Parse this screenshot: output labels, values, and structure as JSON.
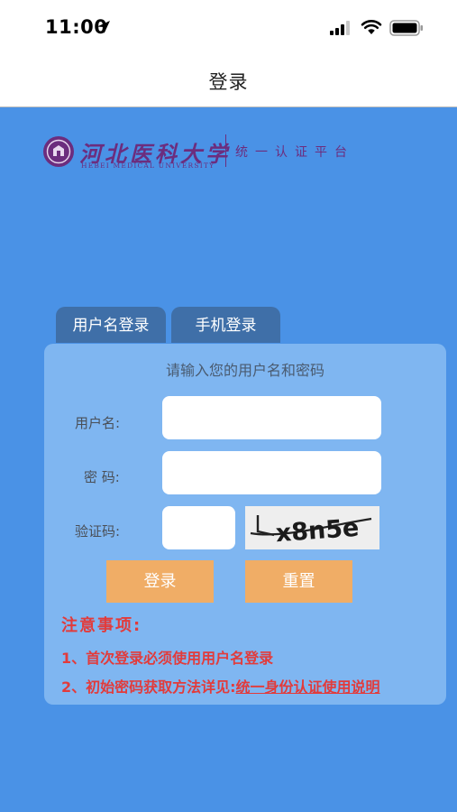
{
  "status_bar": {
    "time": "11:00"
  },
  "nav": {
    "title": "登录"
  },
  "logo": {
    "school_name": "河北医科大学",
    "school_name_en": "HEBEI MEDICAL UNIVERSITY",
    "platform": "统一认证平台"
  },
  "tabs": [
    {
      "label": "用户名登录"
    },
    {
      "label": "手机登录"
    }
  ],
  "form": {
    "hint": "请输入您的用户名和密码",
    "username_label": "用户名:",
    "username_value": "",
    "password_label": "密 码:",
    "password_value": "",
    "captcha_label": "验证码:",
    "captcha_value": "",
    "captcha_text": "x8n5e",
    "login_button": "登录",
    "reset_button": "重置"
  },
  "notes": {
    "title": "注意事项:",
    "item1": "1、首次登录必须使用用户名登录",
    "item2_prefix": "2、初始密码获取方法详见:",
    "item2_link": "统一身份认证使用说明"
  },
  "colors": {
    "main_bg": "#4a92e6",
    "card_bg": "#7fb6f1",
    "tab_bg": "#3f6fa8",
    "button_bg": "#f0ad66",
    "notes_red": "#e23b3b",
    "logo_purple": "#6c2d7e"
  },
  "icons": [
    "location-arrow-icon",
    "signal-icon",
    "wifi-icon",
    "battery-icon",
    "university-emblem-icon"
  ]
}
